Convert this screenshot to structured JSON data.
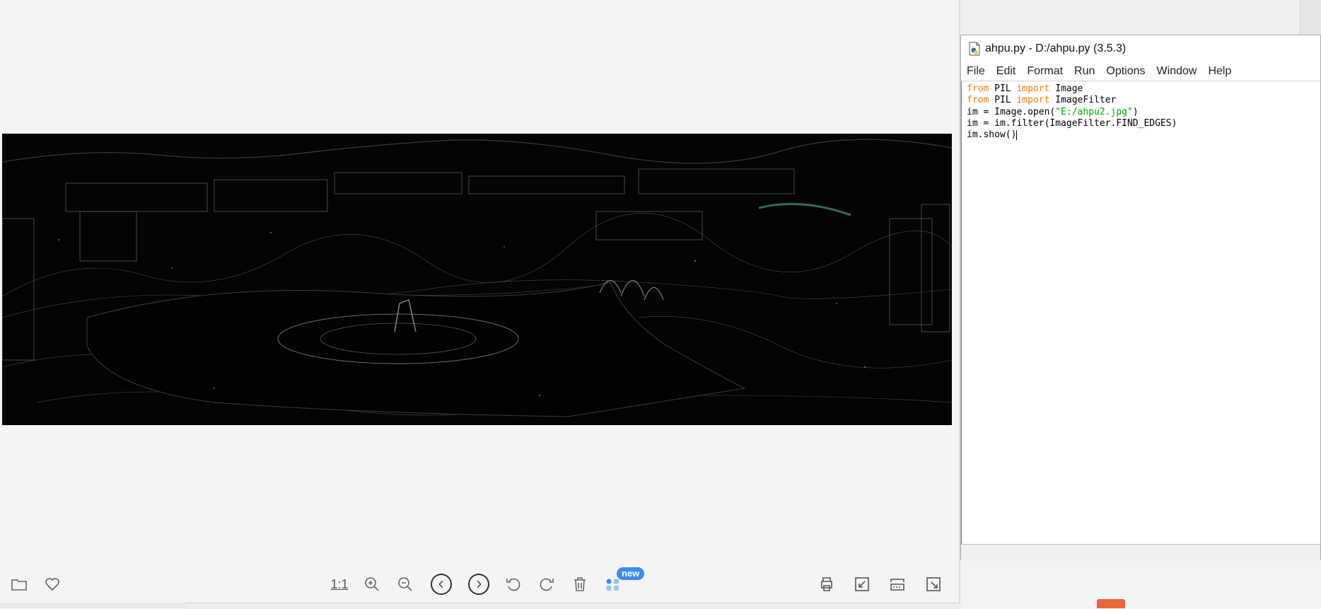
{
  "viewer": {
    "toolbar": {
      "one_to_one": "1:1",
      "new_badge": "new",
      "icons": [
        "folder-icon",
        "heart-icon",
        "zoom-in-icon",
        "zoom-out-icon",
        "previous-icon",
        "next-icon",
        "rotate-left-icon",
        "rotate-right-icon",
        "delete-icon",
        "apps-icon",
        "print-icon",
        "fullscreen-icon",
        "slideshow-icon",
        "fit-window-icon"
      ]
    }
  },
  "idle": {
    "title": "ahpu.py - D:/ahpu.py (3.5.3)",
    "menu": [
      "File",
      "Edit",
      "Format",
      "Run",
      "Options",
      "Window",
      "Help"
    ],
    "code": {
      "l1_kw1": "from",
      "l1_a": " PIL ",
      "l1_kw2": "import",
      "l1_b": " Image",
      "l2_kw1": "from",
      "l2_a": " PIL ",
      "l2_kw2": "import",
      "l2_b": " ImageFilter",
      "l3_a": "im = Image.open(",
      "l3_str": "\"E:/ahpu2.jpg\"",
      "l3_b": ")",
      "l4": "im = im.filter(ImageFilter.FIND_EDGES)",
      "l5": "im.show()"
    },
    "colors": {
      "keyword": "#ff7700",
      "string": "#00aa00"
    }
  }
}
